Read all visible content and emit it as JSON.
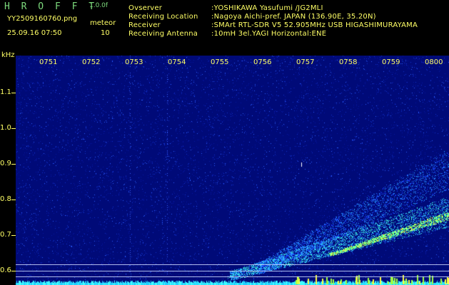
{
  "header": {
    "logo": "H R O F F T",
    "version": "1.0.0f",
    "filename": "YY2509160760.png",
    "datetime": "25.09.16 07:50",
    "mode_label": "meteor",
    "count": "10",
    "meta": [
      {
        "label": "Ovserver",
        "value": ":YOSHIKAWA Yasufumi /JG2MLI"
      },
      {
        "label": "Receiving Location",
        "value": ":Nagoya Aichi-pref. JAPAN (136.90E, 35.20N)"
      },
      {
        "label": "Receiver",
        "value": ":SMArt RTL-SDR V5 52.905MHz USB HIGASHIMURAYAMA"
      },
      {
        "label": "Receiving Antenna",
        "value": ":10mH 3el.YAGI Horizontal:ENE"
      }
    ]
  },
  "spectrogram": {
    "y_unit": "kHz",
    "y_ticks": [
      "1.1",
      "1.0",
      "0.9",
      "0.8",
      "0.7",
      "0.6"
    ],
    "x_ticks": [
      "0751",
      "0752",
      "0753",
      "0754",
      "0755",
      "0756",
      "0757",
      "0758",
      "0759",
      "0800"
    ],
    "colors": {
      "background": "#000a78",
      "text": "#ffff66",
      "logo": "#7cd97c"
    }
  }
}
